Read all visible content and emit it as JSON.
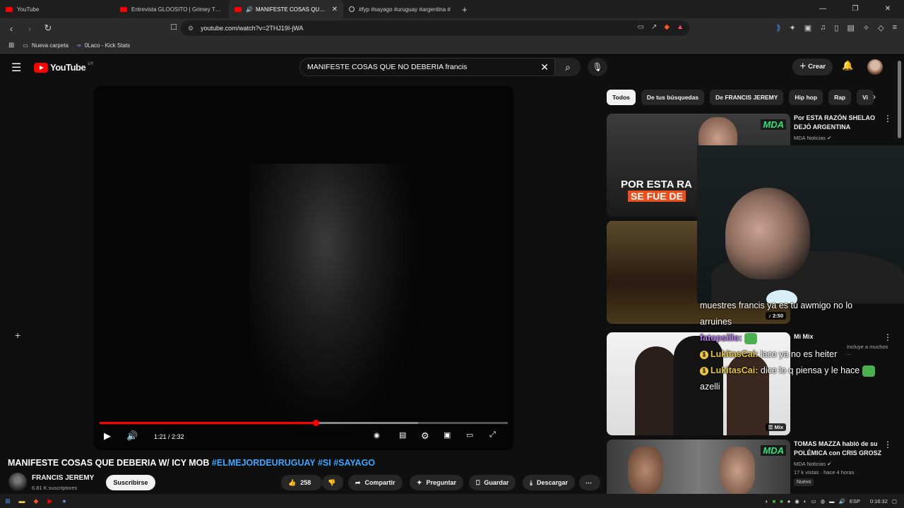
{
  "browser": {
    "tabs": [
      {
        "label": "YouTube",
        "favicon": "youtube-icon"
      },
      {
        "label": "Entrevista GLOOSITO | Grimey TV 5x3",
        "favicon": "youtube-icon"
      },
      {
        "label": "MANIFESTE COSAS QUE DEBE",
        "favicon": "youtube-icon",
        "active": true
      },
      {
        "label": "#fyp #sayago #uruguay #argentina #",
        "favicon": "tiktok-icon"
      }
    ],
    "url": "youtube.com/watch?v=2THJ19I-jWA",
    "bookmarks": [
      {
        "label": "Nueva carpeta",
        "icon": "folder-icon"
      },
      {
        "label": "0Laco - Kick Stats",
        "icon": "link-icon"
      }
    ]
  },
  "header": {
    "logo_text": "YouTube",
    "country_code": "UY",
    "search_query": "MANIFESTE COSAS QUE NO DEBERIA francis",
    "create_label": "Crear"
  },
  "player": {
    "time_display": "1:21 / 2:32",
    "played_fraction": 0.53,
    "loaded_fraction": 0.78
  },
  "video": {
    "title": "MANIFESTE COSAS QUE DEBERIA W/ ICY MOB",
    "hashtags": "#ELMEJORDEURUGUAY #SI #SAYAGO",
    "channel": "FRANCIS JEREMY",
    "subscribers": "6.81 K suscriptores",
    "subscribe_label": "Suscribirse",
    "likes": "258",
    "share_label": "Compartir",
    "ask_label": "Preguntar",
    "save_label": "Guardar",
    "download_label": "Descargar"
  },
  "chips": [
    "Todos",
    "De tus búsquedas",
    "De FRANCIS JEREMY",
    "Hip hop",
    "Rap",
    "Vi"
  ],
  "recommendations": [
    {
      "title": "Por ESTA RAZÓN SHELAO DEJÓ ARGENTINA",
      "channel": "MDA Noticias",
      "thumb_text_1": "POR ESTA RA",
      "thumb_text_2": "SE FUE DE",
      "thumb_badge": "MDA"
    },
    {
      "duration": "2:50"
    },
    {
      "title": "Mi Mix",
      "meta": "Incluye a muchos ...",
      "badge": "Mix"
    },
    {
      "title": "TOMAS MAZZA habló de su POLÉMICA con CRIS GROSZ",
      "channel": "MDA Noticias",
      "views": "17 k vistas · hace 4 horas",
      "new_badge": "Nuevo",
      "thumb_badge": "MDA"
    }
  ],
  "chat": {
    "line1": "muestres francis ya es tu awmigo no lo",
    "line2": "arruines",
    "user1": "fatopsillo:",
    "user2": "LukitasCai:",
    "msg2": "laco ya no es heiter",
    "user3": "LukitasCai:",
    "msg3": "dice lo q piensa y le hace",
    "line4": "azelli"
  },
  "taskbar": {
    "lang": "ESP",
    "clock": "0:16:32"
  }
}
